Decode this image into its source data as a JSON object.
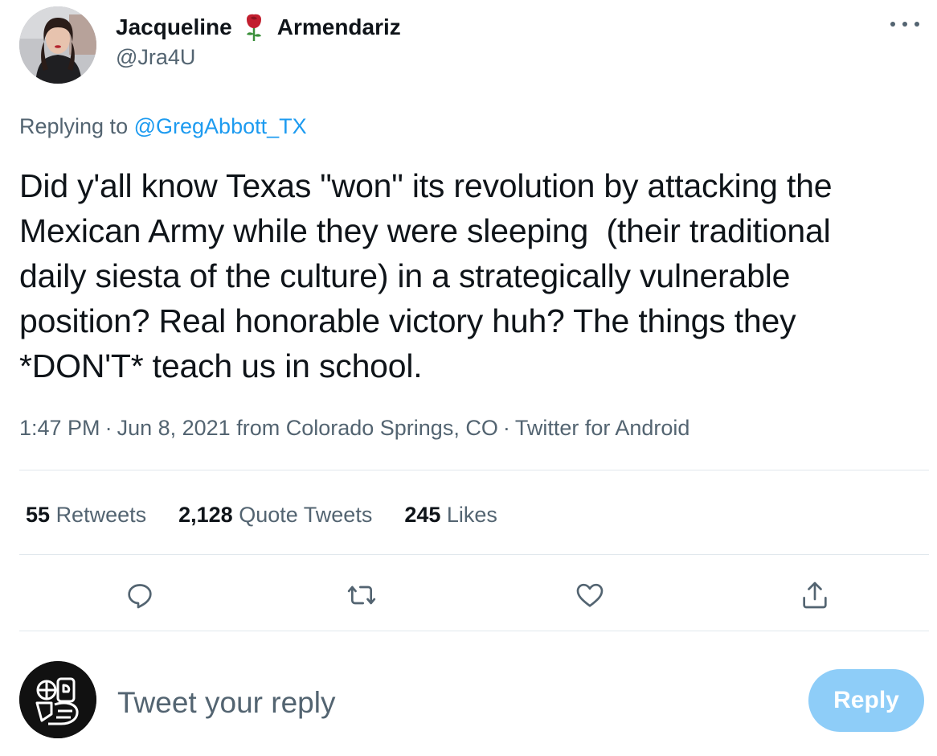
{
  "tweet": {
    "author": {
      "first_name": "Jacqueline",
      "last_name": "Armendariz",
      "emoji": "rose",
      "handle": "@Jra4U"
    },
    "replying_label": "Replying to",
    "replying_to": "@GregAbbott_TX",
    "text": "Did y'all know Texas \"won\" its revolution by attacking the\nMexican Army while they were sleeping  (their traditional\ndaily siesta of the culture) in a strategically vulnerable\nposition? Real honorable victory huh? The things they\n*DON'T* teach us in school.",
    "time": "1:47 PM",
    "date": "Jun 8, 2021",
    "location": "from Colorado Springs, CO",
    "source": "Twitter for Android",
    "separator": "·"
  },
  "stats": {
    "retweets": {
      "count": "55",
      "label": "Retweets"
    },
    "quote_tweets": {
      "count": "2,128",
      "label": "Quote Tweets"
    },
    "likes": {
      "count": "245",
      "label": "Likes"
    }
  },
  "actions": [
    "reply-icon",
    "retweet-icon",
    "like-icon",
    "share-icon"
  ],
  "reply_box": {
    "placeholder": "Tweet your reply",
    "button_label": "Reply"
  },
  "colors": {
    "text": "#0f1419",
    "secondary": "#536471",
    "link": "#1d9bf0",
    "reply_button_disabled": "#8ecdf8",
    "divider": "#e1e8ed"
  }
}
